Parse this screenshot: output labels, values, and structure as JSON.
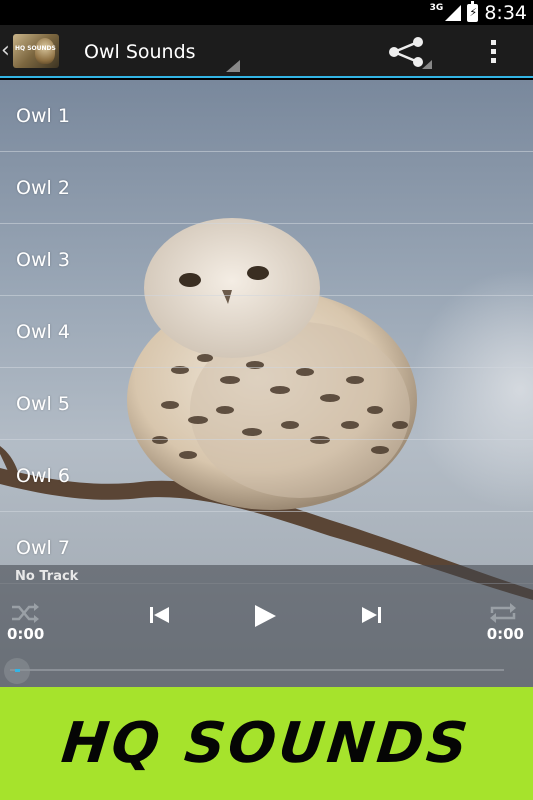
{
  "status_bar": {
    "network": "3G",
    "time": "8:34"
  },
  "action_bar": {
    "title": "Owl Sounds",
    "logo_text": "HQ SOUNDS"
  },
  "tracks": [
    {
      "label": "Owl 1"
    },
    {
      "label": "Owl 2"
    },
    {
      "label": "Owl 3"
    },
    {
      "label": "Owl 4"
    },
    {
      "label": "Owl 5"
    },
    {
      "label": "Owl 6"
    },
    {
      "label": "Owl 7"
    }
  ],
  "player": {
    "track_name": "No Track",
    "elapsed": "0:00",
    "duration": "0:00",
    "progress": 0
  },
  "banner": {
    "text": "HQ SOUNDS"
  },
  "colors": {
    "accent": "#33b5e5",
    "banner": "#a6e32c",
    "action_bar": "#1c1c1c"
  },
  "icons": [
    "up-caret-icon",
    "share-icon",
    "overflow-menu-icon",
    "shuffle-icon",
    "previous-icon",
    "play-icon",
    "next-icon",
    "repeat-icon"
  ]
}
